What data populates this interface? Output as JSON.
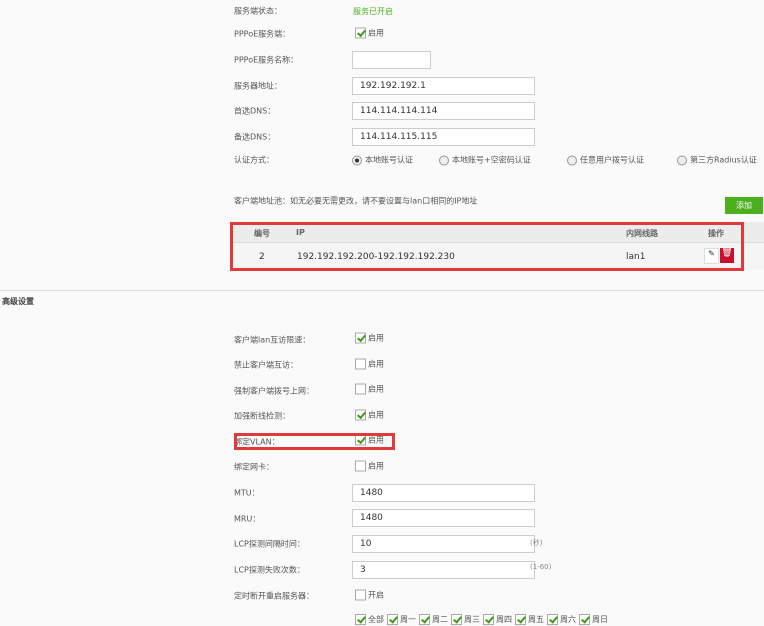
{
  "basic": {
    "status_label": "服务端状态：",
    "status_value": "服务已开启",
    "pppoe_label": "PPPoE服务端：",
    "enable": "启用",
    "name_label": "PPPoE服务名称：",
    "name_value": "",
    "addr_label": "服务器地址：",
    "addr_value": "192.192.192.1",
    "dns1_label": "首选DNS：",
    "dns1_value": "114.114.114.114",
    "dns2_label": "备选DNS：",
    "dns2_value": "114.114.115.115",
    "auth_label": "认证方式：",
    "auth_options": [
      "本地账号认证",
      "本地账号+空密码认证",
      "任意用户拨号认证",
      "第三方Radius认证"
    ],
    "pool_note": "客户端地址池：如无必要无需更改，请不要设置与lan口相同的IP地址",
    "add_button": "添加"
  },
  "pool_table": {
    "headers": [
      "编号",
      "IP",
      "内网线路",
      "操作"
    ],
    "rows": [
      {
        "id": "2",
        "ip": "192.192.192.200-192.192.192.230",
        "line": "lan1"
      }
    ]
  },
  "advanced": {
    "title": "高级设置",
    "enable": "启用",
    "items": [
      "客户端lan互访限速：",
      "禁止客户端互访：",
      "强制客户端拨号上网：",
      "加强断线检测：",
      "绑定VLAN：",
      "绑定网卡："
    ],
    "mtu_label": "MTU：",
    "mtu": "1480",
    "mru_label": "MRU：",
    "mru": "1480",
    "lcp_int_label": "LCP探测间隔时间：",
    "lcp_int": "10",
    "lcp_int_unit": "(秒)",
    "lcp_fail_label": "LCP探测失败次数：",
    "lcp_fail": "3",
    "lcp_fail_range": "(1-60)",
    "restart_label": "定时断开重启服务器：",
    "restart_opt": "开启",
    "days": [
      "全部",
      "周一",
      "周二",
      "周三",
      "周四",
      "周五",
      "周六",
      "周日"
    ]
  },
  "colors": {
    "green": "#4caf1e",
    "red": "#e03a3a",
    "delete": "#c8102e"
  }
}
